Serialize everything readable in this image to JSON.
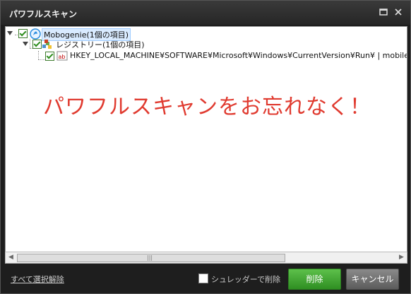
{
  "window": {
    "title": "パワフルスキャン",
    "maximize_icon": "maximize-icon",
    "close_icon": "close-icon"
  },
  "tree": {
    "root": {
      "label": "Mobogenie(1個の項目)",
      "icon": "mobogenie-app-icon"
    },
    "registry": {
      "label": "レジストリー(1個の項目)",
      "icon": "registry-icon"
    },
    "entry": {
      "label": "HKEY_LOCAL_MACHINE¥SOFTWARE¥Microsoft¥Windows¥CurrentVersion¥Run¥ | mobilegeni daemon",
      "icon": "registry-value-ab-icon"
    }
  },
  "overlay": {
    "message": "パワフルスキャンをお忘れなく！"
  },
  "scrollbar": {
    "left_arrow": "◀",
    "right_arrow": "▶",
    "grip": "|||"
  },
  "footer": {
    "deselect_all": "すべて選択解除",
    "shredder_label": "シュレッダーで削除",
    "delete_button": "削除",
    "cancel_button": "キャンセル"
  },
  "colors": {
    "overlay_text": "#e03a2f",
    "delete_button": "#3f9f31",
    "cancel_button": "#6a6a6a"
  }
}
